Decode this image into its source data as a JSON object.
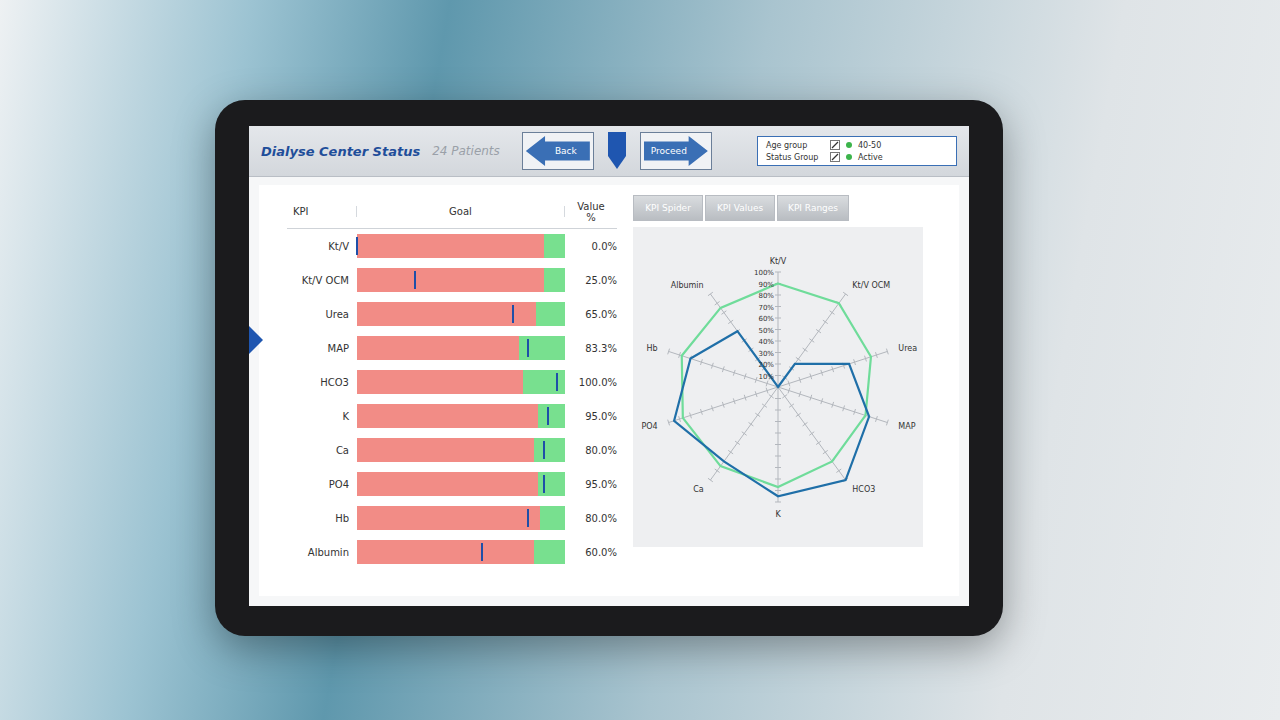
{
  "screen": {
    "title": "Dialyse Center Status",
    "patients": "24 Patients"
  },
  "nav": {
    "back": "Back",
    "proceed": "Proceed"
  },
  "filters": [
    {
      "label": "Age group",
      "value": "40-50",
      "color": "#3cb44b"
    },
    {
      "label": "Status Group",
      "value": "Active",
      "color": "#3cb44b"
    }
  ],
  "tabs": [
    {
      "label": "KPI Spider"
    },
    {
      "label": "KPI Values"
    },
    {
      "label": "KPI Ranges"
    }
  ],
  "table": {
    "columns": [
      {
        "label": "KPI"
      },
      {
        "label": "Goal"
      },
      {
        "label": "Value",
        "unit": "%"
      }
    ],
    "rows": [
      {
        "kpi": "Kt/V",
        "level": 0.0,
        "target": 0.9,
        "value": "0.0%"
      },
      {
        "kpi": "Kt/V OCM",
        "level": 0.28,
        "target": 0.9,
        "value": "25.0%"
      },
      {
        "kpi": "Urea",
        "level": 0.75,
        "target": 0.86,
        "value": "65.0%"
      },
      {
        "kpi": "MAP",
        "level": 0.82,
        "target": 0.78,
        "value": "83.3%"
      },
      {
        "kpi": "HCO3",
        "level": 0.96,
        "target": 0.8,
        "value": "100.0%"
      },
      {
        "kpi": "K",
        "level": 0.92,
        "target": 0.87,
        "value": "95.0%"
      },
      {
        "kpi": "Ca",
        "level": 0.9,
        "target": 0.85,
        "value": "80.0%"
      },
      {
        "kpi": "PO4",
        "level": 0.9,
        "target": 0.87,
        "value": "95.0%"
      },
      {
        "kpi": "Hb",
        "level": 0.82,
        "target": 0.88,
        "value": "80.0%"
      },
      {
        "kpi": "Albumin",
        "level": 0.6,
        "target": 0.85,
        "value": "60.0%"
      }
    ]
  },
  "chart": {
    "axes": [
      "Kt/V",
      "Kt/V OCM",
      "Urea",
      "MAP",
      "HCO3",
      "K",
      "Ca",
      "PO4",
      "Hb",
      "Albumin"
    ],
    "ticks": [
      "100%",
      "90%",
      "80%",
      "70%",
      "60%",
      "50%",
      "40%",
      "30%",
      "20%",
      "10%"
    ],
    "series": [
      {
        "color": "#6fdc9a",
        "values": [
          90,
          90,
          85,
          80,
          80,
          87,
          85,
          87,
          88,
          85
        ]
      },
      {
        "color": "#1f6fa8",
        "values": [
          0,
          25,
          65,
          83.3,
          100,
          95,
          80,
          95,
          80,
          60
        ]
      }
    ]
  }
}
